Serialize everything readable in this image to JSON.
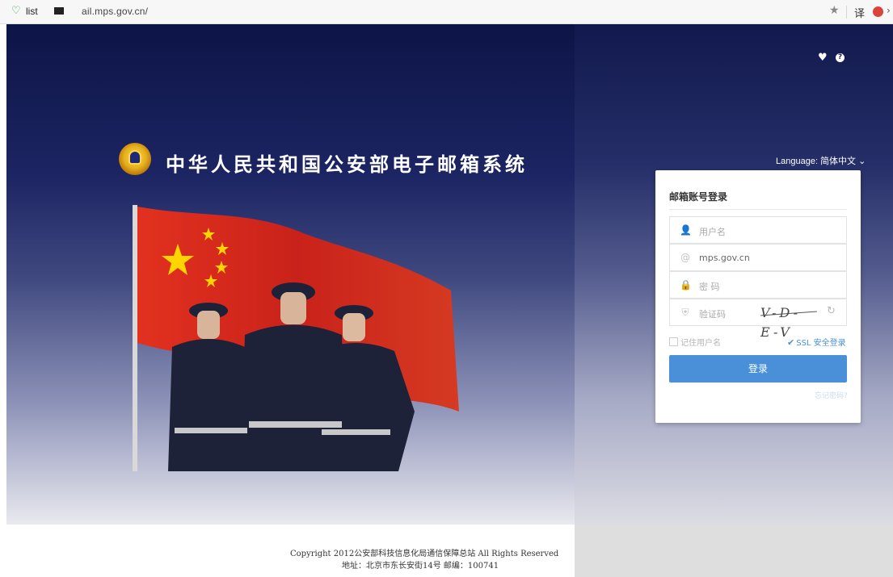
{
  "browser": {
    "tab_label": "list",
    "url": "ail.mps.gov.cn/"
  },
  "site": {
    "title": "中华人民共和国公安部电子邮箱系统",
    "language_label": "Language: 简体中文",
    "language_caret": "⌄"
  },
  "login": {
    "heading": "邮箱账号登录",
    "username_placeholder": "用户名",
    "domain": "mps.gov.cn",
    "password_placeholder": "密 码",
    "captcha_placeholder": "验证码",
    "captcha_text": "V-D-E-V",
    "remember_label": "记住用户名",
    "ssl_label": "SSL 安全登录",
    "ssl_checked": true,
    "submit_label": "登录",
    "forgot_label": "忘记密码?"
  },
  "footer": {
    "copyright": "Copyright 2012公安部科技信息化局通信保障总站 All Rights Reserved",
    "address": "地址：北京市东长安街14号  邮编：100741"
  },
  "colors": {
    "primary_button": "#4a90d9",
    "hero_top": "#0d1446",
    "flag_red": "#d42a1e",
    "flag_star": "#ffd400"
  },
  "icons": [
    "shield-icon",
    "star-icon",
    "heart-icon",
    "help-icon",
    "user-icon",
    "at-icon",
    "lock-icon",
    "captcha-shield-icon",
    "refresh-icon",
    "check-icon"
  ]
}
